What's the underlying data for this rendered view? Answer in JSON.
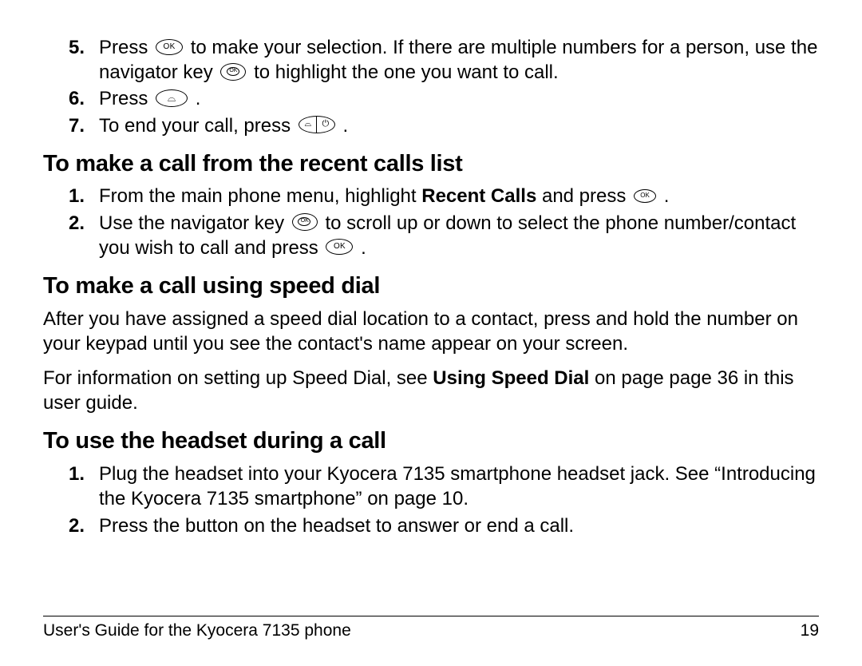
{
  "top_steps": [
    {
      "n": "5.",
      "pre": "Press ",
      "icon": "ok",
      "post": " to make your selection. If there are multiple numbers for a person, use the navigator key ",
      "icon2": "nav",
      "post2": " to highlight the one you want to call."
    },
    {
      "n": "6.",
      "pre": "Press ",
      "icon": "call",
      "post": "."
    },
    {
      "n": "7.",
      "pre": "To end your call, press ",
      "icon": "end",
      "post": "."
    }
  ],
  "section1": {
    "title": "To make a call from the recent calls list",
    "steps": [
      {
        "n": "1.",
        "pre": "From the main phone menu, highlight ",
        "bold": "Recent Calls",
        "mid": " and press ",
        "icon": "ok-sm",
        "post": "."
      },
      {
        "n": "2.",
        "pre": "Use the navigator key ",
        "icon": "nav",
        "mid": " to scroll up or down to select the phone number/contact you wish to call and press ",
        "icon2": "ok",
        "post": "."
      }
    ]
  },
  "section2": {
    "title": "To make a call using speed dial",
    "p1": "After you have assigned a speed dial location to a contact, press and hold the number on your keypad until you see the contact's name appear on your screen.",
    "p2_pre": "For information on setting up Speed Dial, see ",
    "p2_bold": "Using Speed Dial",
    "p2_post": " on page page 36 in this user guide."
  },
  "section3": {
    "title": "To use the headset during a call",
    "steps": [
      {
        "n": "1.",
        "text": "Plug the headset into your Kyocera 7135 smartphone headset jack. See “Introducing the Kyocera 7135 smartphone” on page 10."
      },
      {
        "n": "2.",
        "text": "Press the button on the headset to answer or end a call."
      }
    ]
  },
  "footer": {
    "left": "User's Guide for the Kyocera 7135 phone",
    "right": "19"
  },
  "icon_labels": {
    "ok": "OK",
    "ok_sm": "OK"
  }
}
